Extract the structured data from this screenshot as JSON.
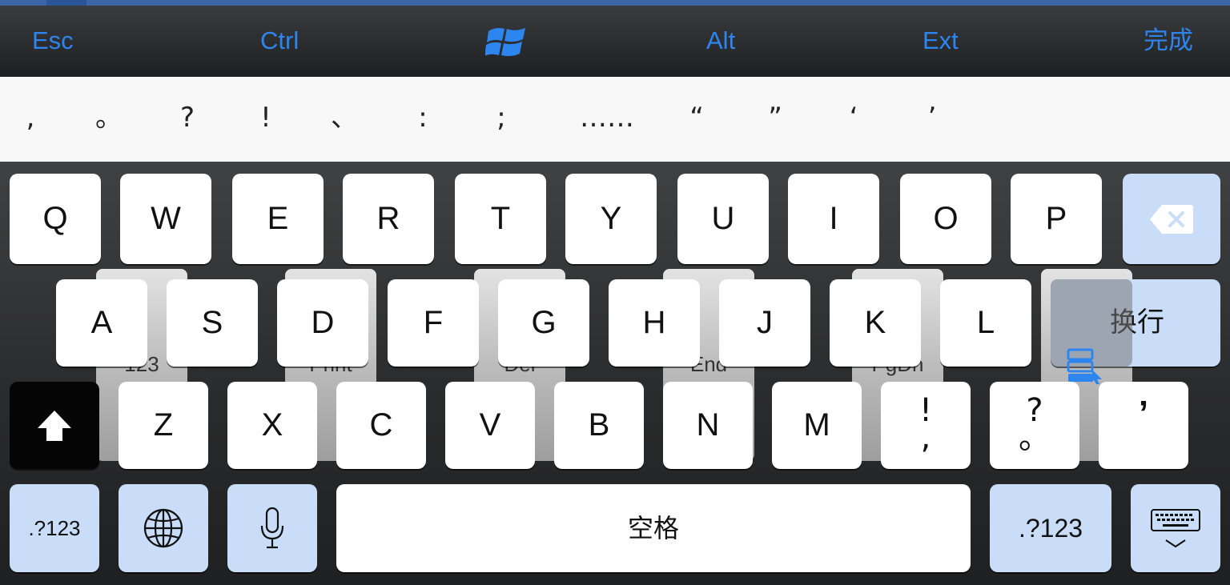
{
  "toolbar": {
    "esc": "Esc",
    "ctrl": "Ctrl",
    "windows_icon": "windows-logo-icon",
    "alt": "Alt",
    "ext": "Ext",
    "done": "完成",
    "text_color": "#2d86f0"
  },
  "candidates": [
    ",",
    "。",
    "?",
    "!",
    "、",
    ":",
    ";",
    "……",
    "“",
    "”",
    "‘",
    "’"
  ],
  "rows": {
    "row1": [
      "Q",
      "W",
      "E",
      "R",
      "T",
      "Y",
      "U",
      "I",
      "O",
      "P"
    ],
    "row2": [
      "A",
      "S",
      "D",
      "F",
      "G",
      "H",
      "J",
      "K",
      "L"
    ],
    "row3": [
      "Z",
      "X",
      "C",
      "V",
      "B",
      "N",
      "M"
    ]
  },
  "dual_keys": [
    {
      "top": "!",
      "bottom": ","
    },
    {
      "top": "?",
      "bottom": "。"
    }
  ],
  "comma_key": "’",
  "enter_label": "换行",
  "space_label": "空格",
  "numbers_label": ".?123",
  "ghost_labels": [
    "123",
    "Print",
    "Del",
    "End",
    "PgDn"
  ],
  "icons": {
    "backspace": "backspace-icon",
    "shift": "shift-icon",
    "globe": "globe-icon",
    "mic": "microphone-icon",
    "hide_keyboard": "keyboard-hide-icon",
    "system": "system-menu-icon"
  },
  "colors": {
    "function_key": "#c9dcf8",
    "key": "#ffffff",
    "shift_key": "#050505"
  }
}
